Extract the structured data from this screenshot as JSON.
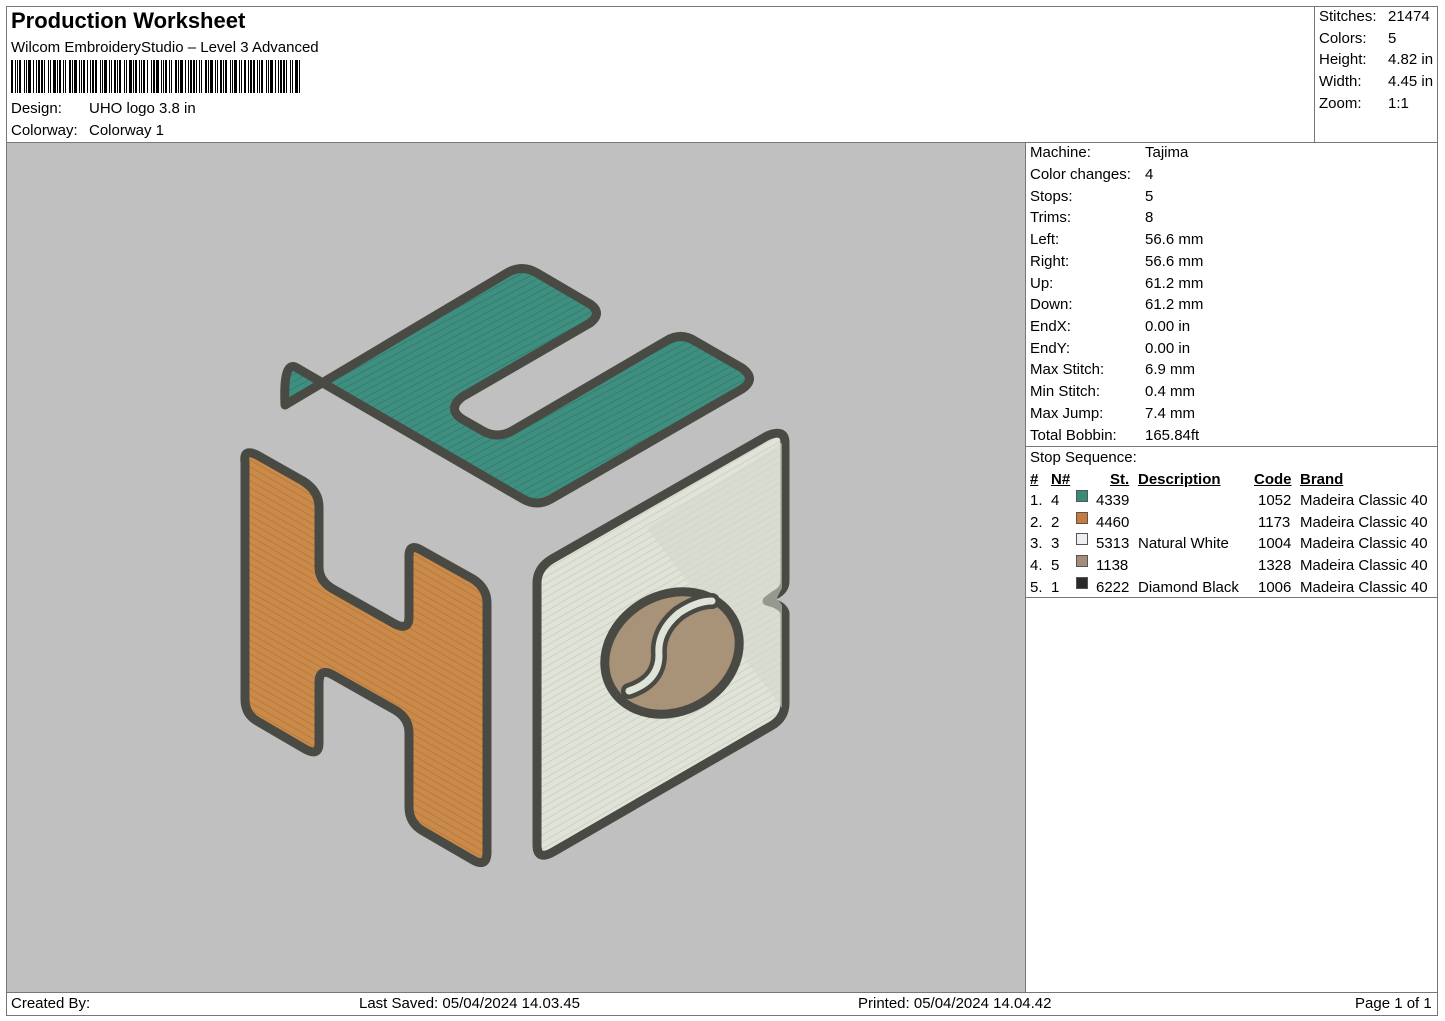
{
  "header": {
    "title": "Production Worksheet",
    "software": "Wilcom EmbroideryStudio – Level 3 Advanced",
    "design_label": "Design:",
    "design_value": "UHO logo 3.8 in",
    "colorway_label": "Colorway:",
    "colorway_value": "Colorway 1"
  },
  "stats": [
    {
      "label": "Stitches:",
      "value": "21474"
    },
    {
      "label": "Colors:",
      "value": "5"
    },
    {
      "label": "Height:",
      "value": "4.82 in"
    },
    {
      "label": "Width:",
      "value": "4.45 in"
    },
    {
      "label": "Zoom:",
      "value": "1:1"
    }
  ],
  "machine_info": [
    {
      "label": "Machine:",
      "value": "Tajima"
    },
    {
      "label": "Color changes:",
      "value": "4"
    },
    {
      "label": "Stops:",
      "value": "5"
    },
    {
      "label": "Trims:",
      "value": "8"
    },
    {
      "label": "Left:",
      "value": "56.6 mm"
    },
    {
      "label": "Right:",
      "value": "56.6 mm"
    },
    {
      "label": "Up:",
      "value": "61.2 mm"
    },
    {
      "label": "Down:",
      "value": "61.2 mm"
    },
    {
      "label": "EndX:",
      "value": "0.00 in"
    },
    {
      "label": "EndY:",
      "value": "0.00 in"
    },
    {
      "label": "Max Stitch:",
      "value": "6.9 mm"
    },
    {
      "label": "Min Stitch:",
      "value": "0.4 mm"
    },
    {
      "label": "Max Jump:",
      "value": "7.4 mm"
    },
    {
      "label": "Total Bobbin:",
      "value": "165.84ft"
    }
  ],
  "stop_sequence": {
    "title": "Stop Sequence:",
    "headers": {
      "num": "#",
      "n": "N#",
      "st": "St.",
      "desc": "Description",
      "code": "Code",
      "brand": "Brand"
    },
    "rows": [
      {
        "num": "1.",
        "n": "4",
        "color": "#3a8a7c",
        "st": "4339",
        "desc": "",
        "code": "1052",
        "brand": "Madeira Classic 40"
      },
      {
        "num": "2.",
        "n": "2",
        "color": "#c87a3c",
        "st": "4460",
        "desc": "",
        "code": "1173",
        "brand": "Madeira Classic 40"
      },
      {
        "num": "3.",
        "n": "3",
        "color": "#eeedf2",
        "st": "5313",
        "desc": "Natural White",
        "code": "1004",
        "brand": "Madeira Classic 40"
      },
      {
        "num": "4.",
        "n": "5",
        "color": "#a48c7c",
        "st": "1138",
        "desc": "",
        "code": "1328",
        "brand": "Madeira Classic 40"
      },
      {
        "num": "5.",
        "n": "1",
        "color": "#2a2a2a",
        "st": "6222",
        "desc": "Diamond Black",
        "code": "1006",
        "brand": "Madeira Classic 40"
      }
    ]
  },
  "footer": {
    "created_by": "Created By:",
    "last_saved": "Last Saved: 05/04/2024 14.03.45",
    "printed": "Printed: 05/04/2024 14.04.42",
    "page": "Page 1 of 1"
  },
  "colors": {
    "canvas": "#c0c0c0",
    "teal": "#3f8f80",
    "orange": "#c98a4a",
    "light": "#dfe3d8",
    "bean": "#a89278",
    "outline": "#4a4a44"
  }
}
